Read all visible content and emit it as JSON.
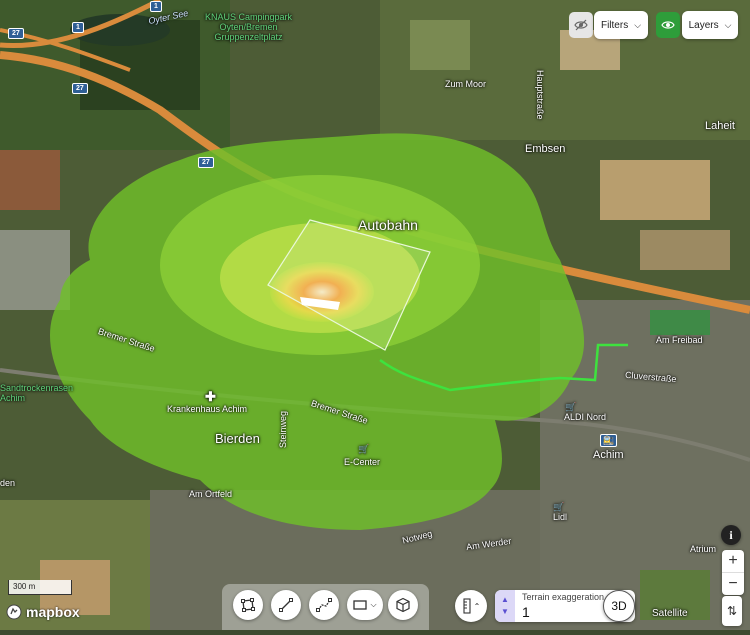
{
  "top_bar": {
    "filters_label": "Filters",
    "layers_label": "Layers",
    "hide_icon": "eye-off-icon",
    "layers_icon": "eye-icon"
  },
  "map_labels": {
    "oyter_see": "Oyter See",
    "knaus_line1": "KNAUS Campingpark",
    "knaus_line2": "Oyten/Bremen",
    "knaus_line3": "Gruppenzeltplatz",
    "hauptstrasse": "Hauptstraße",
    "zum_moor": "Zum Moor",
    "laheit": "Laheit",
    "embsen": "Embsen",
    "autobahn": "Autobahn",
    "am_freibad": "Am Freibad",
    "cluverstrasse": "Cluverstraße",
    "bremer_strasse_1": "Bremer Straße",
    "bremer_strasse_2": "Bremer Straße",
    "sandtrocken_1": "Sandtrockenrasen",
    "sandtrocken_2": "Achim",
    "krankenhaus": "Krankenhaus Achim",
    "bierden": "Bierden",
    "steinweg": "Steinweg",
    "e_center": "E-Center",
    "aldi_nord": "ALDI Nord",
    "achim": "Achim",
    "am_ortfeld": "Am Ortfeld",
    "bierden_partial": "den",
    "notweg": "Notweg",
    "am_werder": "Am Werder",
    "lidl": "Lidl",
    "atrium": "Atrium",
    "satellite": "Satellite"
  },
  "shields": {
    "s1a": "1",
    "s1b": "1",
    "s27a": "27",
    "s27b": "27",
    "s27c": "27"
  },
  "scale_label": "300 m",
  "logo_text": "mapbox",
  "bottom_toolbar": {
    "terrain_label": "Terrain exaggeration",
    "terrain_value": "1",
    "btn_3d": "3D"
  },
  "colors": {
    "heat_outer": "#6fbf2a",
    "heat_mid": "#9cd63a",
    "heat_inner": "#d9e24a",
    "heat_core": "#f0a53b",
    "route": "#3ee23e",
    "highway": "#d98b3c",
    "accent_green": "#2e9d3a"
  }
}
